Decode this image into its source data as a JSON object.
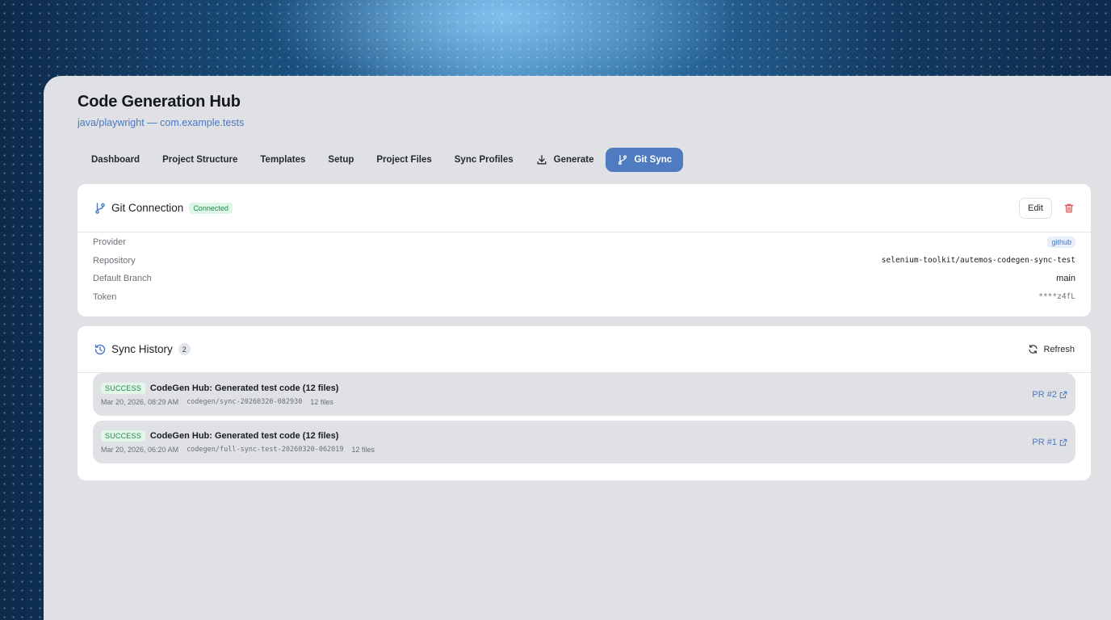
{
  "header": {
    "title": "Code Generation Hub",
    "subtitle": "java/playwright — com.example.tests"
  },
  "tabs": [
    {
      "label": "Dashboard"
    },
    {
      "label": "Project Structure"
    },
    {
      "label": "Templates"
    },
    {
      "label": "Setup"
    },
    {
      "label": "Project Files"
    },
    {
      "label": "Sync Profiles"
    },
    {
      "label": "Generate",
      "icon": "download-icon"
    },
    {
      "label": "Git Sync",
      "icon": "git-branch-icon",
      "active": true
    }
  ],
  "git_connection": {
    "title": "Git Connection",
    "status": "Connected",
    "edit_label": "Edit",
    "fields": [
      {
        "key": "Provider",
        "value": "github"
      },
      {
        "key": "Repository",
        "value": "selenium-toolkit/autemos-codegen-sync-test"
      },
      {
        "key": "Default Branch",
        "value": "main"
      },
      {
        "key": "Token",
        "value": "****z4fL"
      }
    ]
  },
  "sync_history": {
    "title": "Sync History",
    "count": "2",
    "refresh_label": "Refresh",
    "items": [
      {
        "status": "SUCCESS",
        "message": "CodeGen Hub: Generated test code (12 files)",
        "date": "Mar 20, 2026, 08:29 AM",
        "branch": "codegen/sync-20260320-082930",
        "files": "12 files",
        "pr": "PR #2"
      },
      {
        "status": "SUCCESS",
        "message": "CodeGen Hub: Generated test code (12 files)",
        "date": "Mar 20, 2026, 06:20 AM",
        "branch": "codegen/full-sync-test-20260320-062019",
        "files": "12 files",
        "pr": "PR #1"
      }
    ]
  },
  "colors": {
    "accent": "#4f7cc0",
    "success": "#1f8a4c",
    "danger": "#e05252",
    "panel": "#dfe1e5"
  }
}
